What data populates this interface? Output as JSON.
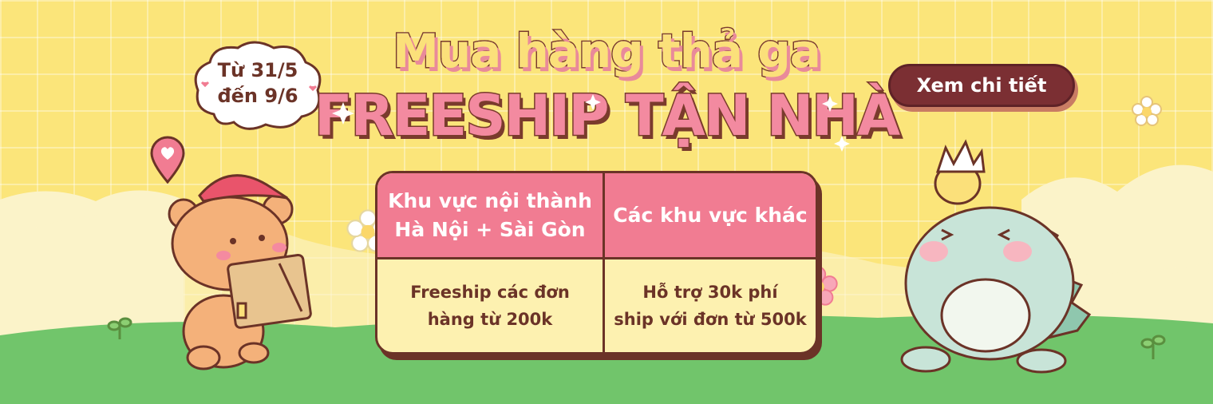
{
  "promo": {
    "date_line1": "Từ 31/5",
    "date_line2": "đến 9/6",
    "title_line1": "Mua hàng thả ga",
    "title_line2": "FREESHIP TẬN NHÀ",
    "cta_label": "Xem chi tiết"
  },
  "table": {
    "header_left_line1": "Khu vực nội thành",
    "header_left_line2": "Hà Nội + Sài Gòn",
    "header_right": "Các khu vực khác",
    "body_left_line1": "Freeship các đơn",
    "body_left_line2": "hàng từ 200k",
    "body_right_line1": "Hỗ trợ 30k phí",
    "body_right_line2": "ship với đơn từ 500k"
  },
  "colors": {
    "background": "#fbe57a",
    "grass": "#71c56b",
    "accent_pink": "#f17c92",
    "outline_brown": "#6b3327",
    "button": "#7b2f33"
  },
  "icons": [
    "heart-pin-icon",
    "flower-icon",
    "sprout-icon",
    "sparkle-icon"
  ]
}
